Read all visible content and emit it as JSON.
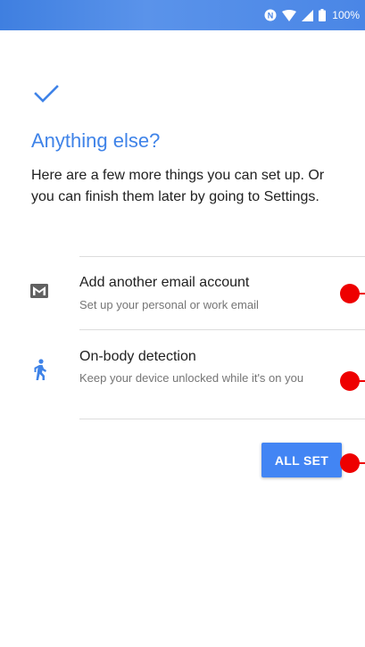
{
  "status_bar": {
    "battery": "100%",
    "icons": [
      "nfc-icon",
      "wifi-icon",
      "cell-signal-icon",
      "battery-icon"
    ]
  },
  "header": {
    "check_icon": "check-icon",
    "title": "Anything else?",
    "description": "Here are a few more things you can set up. Or you can finish them later by going to Settings."
  },
  "options": [
    {
      "icon": "gmail-icon",
      "title": "Add another email account",
      "subtitle": "Set up your personal or work email"
    },
    {
      "icon": "walking-person-icon",
      "title": "On-body detection",
      "subtitle": "Keep your device unlocked while it's on you"
    }
  ],
  "actions": {
    "all_set_label": "ALL SET"
  },
  "colors": {
    "accent": "#4285f4",
    "title": "#3f83e8",
    "status_bar": "#4a86e6",
    "marker": "#ee0000"
  }
}
